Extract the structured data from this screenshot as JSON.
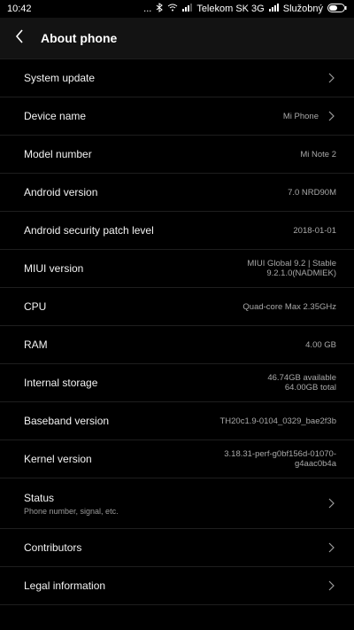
{
  "status_bar": {
    "time": "10:42",
    "dots": "...",
    "carrier": "Telekom SK 3G",
    "profile": "Služobný",
    "colors": {
      "text": "#ffffff"
    }
  },
  "header": {
    "title": "About phone",
    "back_icon": "chevron-left-icon"
  },
  "items": [
    {
      "label": "System update",
      "has_chevron": true
    },
    {
      "label": "Device name",
      "value": "Mi Phone",
      "has_chevron": true
    },
    {
      "label": "Model number",
      "value": "Mi Note 2"
    },
    {
      "label": "Android version",
      "value": "7.0 NRD90M"
    },
    {
      "label": "Android security patch level",
      "value": "2018-01-01"
    },
    {
      "label": "MIUI version",
      "value_line1": "MIUI Global 9.2 | Stable",
      "value_line2": "9.2.1.0(NADMIEK)"
    },
    {
      "label": "CPU",
      "value": "Quad-core Max 2.35GHz"
    },
    {
      "label": "RAM",
      "value": "4.00 GB"
    },
    {
      "label": "Internal storage",
      "value_line1": "46.74GB available",
      "value_line2": "64.00GB total"
    },
    {
      "label": "Baseband version",
      "value": "TH20c1.9-0104_0329_bae2f3b"
    },
    {
      "label": "Kernel version",
      "value_line1": "3.18.31-perf-g0bf156d-01070-",
      "value_line2": "g4aac0b4a"
    },
    {
      "label": "Status",
      "sublabel": "Phone number, signal, etc.",
      "has_chevron": true
    },
    {
      "label": "Contributors",
      "has_chevron": true
    },
    {
      "label": "Legal information",
      "has_chevron": true
    }
  ],
  "colors": {
    "background": "#000000",
    "appbar": "#131313",
    "divider": "#1e1e1e",
    "label": "#f2f2f2",
    "value": "#a8a8a8"
  }
}
